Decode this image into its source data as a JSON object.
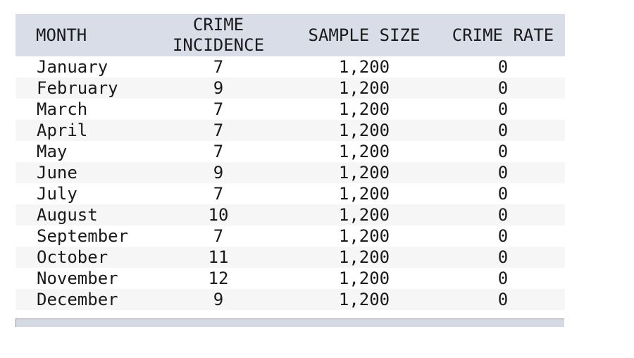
{
  "headers": {
    "month": "MONTH",
    "incidence_line1": "CRIME",
    "incidence_line2": "INCIDENCE",
    "sample_size": "SAMPLE SIZE",
    "crime_rate": "CRIME RATE"
  },
  "rows": [
    {
      "month": "January",
      "incidence": "7",
      "sample": "1,200",
      "rate": "0"
    },
    {
      "month": "February",
      "incidence": "9",
      "sample": "1,200",
      "rate": "0"
    },
    {
      "month": "March",
      "incidence": "7",
      "sample": "1,200",
      "rate": "0"
    },
    {
      "month": "April",
      "incidence": "7",
      "sample": "1,200",
      "rate": "0"
    },
    {
      "month": "May",
      "incidence": "7",
      "sample": "1,200",
      "rate": "0"
    },
    {
      "month": "June",
      "incidence": "9",
      "sample": "1,200",
      "rate": "0"
    },
    {
      "month": "July",
      "incidence": "7",
      "sample": "1,200",
      "rate": "0"
    },
    {
      "month": "August",
      "incidence": "10",
      "sample": "1,200",
      "rate": "0"
    },
    {
      "month": "September",
      "incidence": "7",
      "sample": "1,200",
      "rate": "0"
    },
    {
      "month": "October",
      "incidence": "11",
      "sample": "1,200",
      "rate": "0"
    },
    {
      "month": "November",
      "incidence": "12",
      "sample": "1,200",
      "rate": "0"
    },
    {
      "month": "December",
      "incidence": "9",
      "sample": "1,200",
      "rate": "0"
    }
  ],
  "colors": {
    "header_bg": "#d9dde8",
    "row_alt_bg": "#f6f6f6",
    "scrollbar_bg": "#d5d9e2"
  }
}
